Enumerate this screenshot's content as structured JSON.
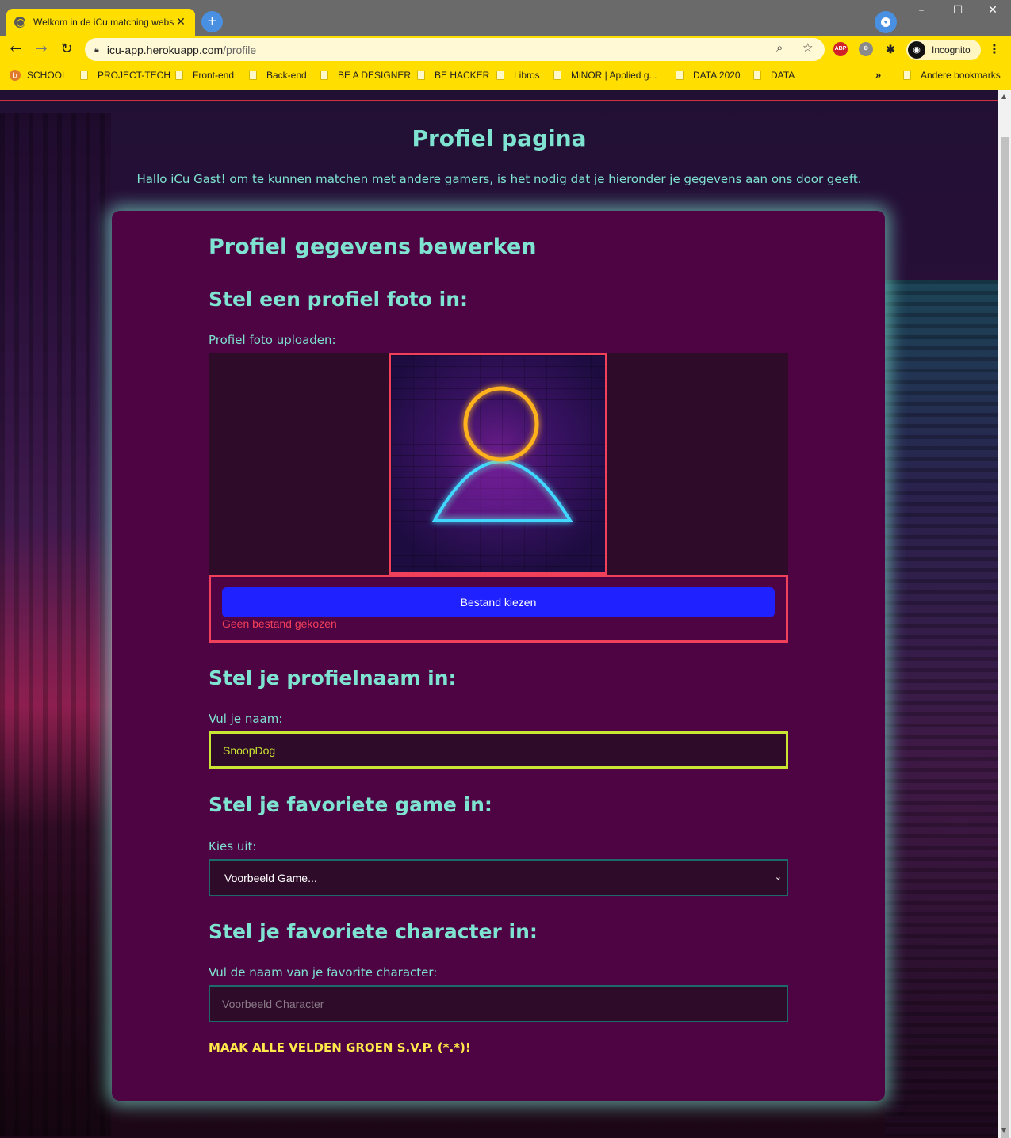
{
  "browser": {
    "tab_title": "Welkom in de iCu matching website",
    "new_tab": "+",
    "url_host": "icu-app.herokuapp.com",
    "url_path": "/profile",
    "incognito_label": "Incognito",
    "window_controls": {
      "minimize": "–",
      "maximize": "☐",
      "close": "✕"
    },
    "extensions": [
      "ABP"
    ],
    "bookmarks": [
      {
        "label": "SCHOOL",
        "type": "site"
      },
      {
        "label": "PROJECT-TECH",
        "type": "folder"
      },
      {
        "label": "Front-end",
        "type": "folder"
      },
      {
        "label": "Back-end",
        "type": "folder"
      },
      {
        "label": "BE A DESIGNER",
        "type": "folder"
      },
      {
        "label": "BE HACKER",
        "type": "folder"
      },
      {
        "label": "Libros",
        "type": "folder"
      },
      {
        "label": "MiNOR | Applied g...",
        "type": "folder"
      },
      {
        "label": "DATA 2020",
        "type": "folder"
      },
      {
        "label": "DATA",
        "type": "folder"
      }
    ],
    "bookmarks_more": "»",
    "other_bookmarks": "Andere bookmarks"
  },
  "page": {
    "title": "Profiel pagina",
    "intro": "Hallo iCu Gast! om te kunnen matchen met andere gamers, is het nodig dat je hieronder je gegevens aan ons door geeft."
  },
  "form": {
    "heading": "Profiel gegevens bewerken",
    "photo": {
      "heading": "Stel een profiel foto in:",
      "label": "Profiel foto uploaden:",
      "button": "Bestand kiezen",
      "status": "Geen bestand gekozen"
    },
    "name": {
      "heading": "Stel je profielnaam in:",
      "label": "Vul je naam:",
      "value": "SnoopDog"
    },
    "game": {
      "heading": "Stel je favoriete game in:",
      "label": "Kies uit:",
      "selected": "Voorbeeld Game..."
    },
    "character": {
      "heading": "Stel je favoriete character in:",
      "label": "Vul de naam van je favorite character:",
      "placeholder": "Voorbeeld Character",
      "value": ""
    },
    "warning": "MAAK ALLE VELDEN GROEN S.V.P. (*.*)!"
  },
  "colors": {
    "accent": "#7ee3d0",
    "card": "#4e0343",
    "error": "#f0405a",
    "valid": "#c8e632",
    "button": "#1f21ff",
    "warning": "#ffe84a",
    "chrome": "#ffde00"
  }
}
